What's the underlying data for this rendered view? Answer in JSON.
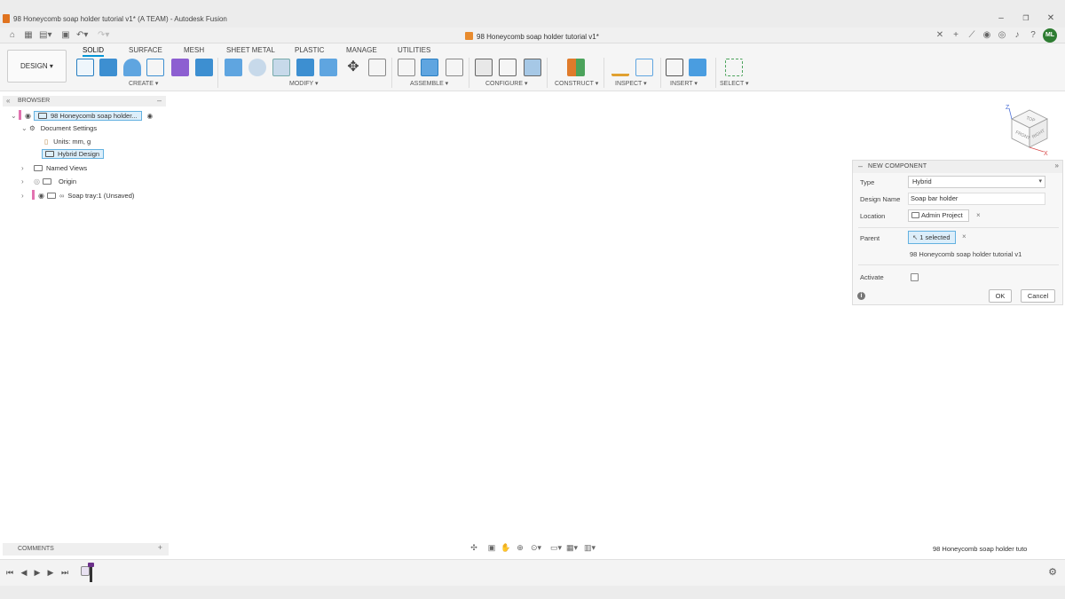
{
  "window": {
    "title": "98 Honeycomb soap holder tutorial v1* (A TEAM) - Autodesk Fusion",
    "minimize": "–",
    "restore": "❐",
    "close": "✕"
  },
  "document_tab": {
    "label": "98 Honeycomb soap holder tutorial v1*",
    "close": "✕"
  },
  "user": {
    "initials": "ML"
  },
  "workspace": {
    "label": "DESIGN ▾"
  },
  "ribbon": {
    "tabs": [
      "SOLID",
      "SURFACE",
      "MESH",
      "SHEET METAL",
      "PLASTIC",
      "MANAGE",
      "UTILITIES"
    ],
    "active_tab": "SOLID",
    "groups": [
      "CREATE ▾",
      "MODIFY ▾",
      "ASSEMBLE ▾",
      "CONFIGURE ▾",
      "CONSTRUCT ▾",
      "INSPECT ▾",
      "INSERT ▾",
      "SELECT ▾"
    ]
  },
  "browser": {
    "header": "BROWSER",
    "items": [
      {
        "label": "98 Honeycomb soap holder..."
      },
      {
        "label": "Document Settings"
      },
      {
        "label": "Units: mm, g"
      },
      {
        "label": "Hybrid Design"
      },
      {
        "label": "Named Views"
      },
      {
        "label": "Origin"
      },
      {
        "label": "Soap tray:1 (Unsaved)"
      }
    ]
  },
  "viewcube": {
    "top": "TOP",
    "front": "FRONT",
    "right": "RIGHT",
    "axis_z": "Z",
    "axis_x": "X"
  },
  "dialog": {
    "title": "NEW COMPONENT",
    "type_label": "Type",
    "type_value": "Hybrid",
    "design_name_label": "Design Name",
    "design_name_value": "Soap bar holder",
    "location_label": "Location",
    "location_value": "Admin Project",
    "parent_label": "Parent",
    "parent_value": "1 selected",
    "parent_name": "98 Honeycomb soap holder tutorial v1",
    "activate_label": "Activate",
    "ok_label": "OK",
    "cancel_label": "Cancel",
    "clear_symbol": "×"
  },
  "comments": {
    "header": "COMMENTS",
    "add": "+"
  },
  "status": {
    "right_text": "98 Honeycomb soap holder tuto"
  },
  "colors": {
    "accent": "#0696d7",
    "selection_bg": "#dceefa",
    "selection_border": "#63b1e0",
    "avatar": "#2e7d32",
    "brand_orange": "#e0731f"
  }
}
